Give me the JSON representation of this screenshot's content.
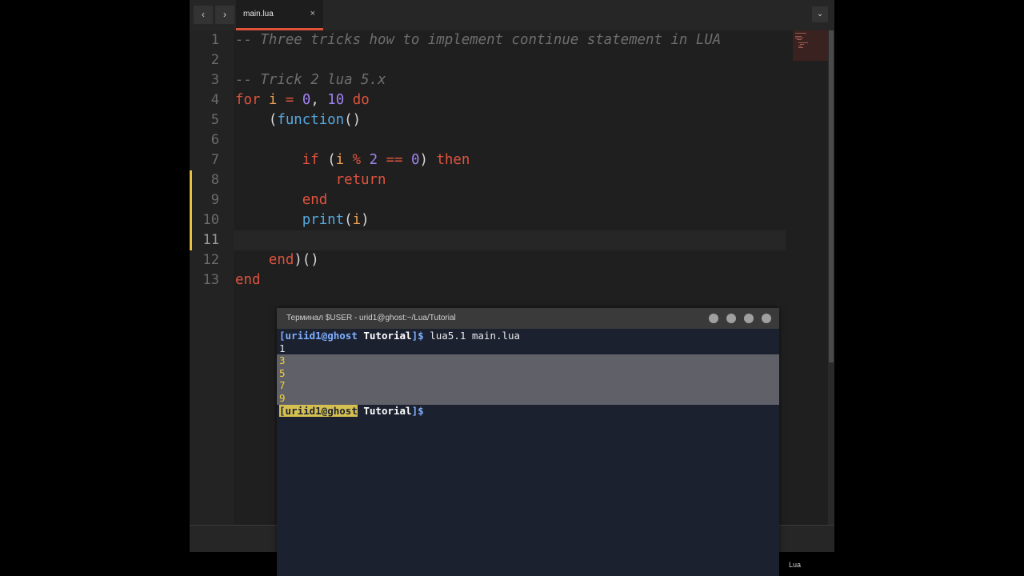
{
  "tabbar": {
    "back_icon": "‹",
    "forward_icon": "›",
    "dropdown_icon": "⌄"
  },
  "tab": {
    "label": "main.lua",
    "close": "×"
  },
  "editor": {
    "lines": [
      {
        "num": "1",
        "tokens": [
          {
            "t": "cm",
            "v": "-- Three tricks how to implement continue statement in LUA"
          }
        ]
      },
      {
        "num": "2",
        "tokens": []
      },
      {
        "num": "3",
        "tokens": [
          {
            "t": "cm",
            "v": "-- Trick 2 lua 5.x"
          }
        ]
      },
      {
        "num": "4",
        "tokens": [
          {
            "t": "kw",
            "v": "for"
          },
          {
            "t": "pl",
            "v": " "
          },
          {
            "t": "var",
            "v": "i"
          },
          {
            "t": "pl",
            "v": " "
          },
          {
            "t": "op",
            "v": "="
          },
          {
            "t": "pl",
            "v": " "
          },
          {
            "t": "num",
            "v": "0"
          },
          {
            "t": "pl",
            "v": ", "
          },
          {
            "t": "num",
            "v": "10"
          },
          {
            "t": "pl",
            "v": " "
          },
          {
            "t": "kw",
            "v": "do"
          }
        ]
      },
      {
        "num": "5",
        "tokens": [
          {
            "t": "pl",
            "v": "    ("
          },
          {
            "t": "fn",
            "v": "function"
          },
          {
            "t": "pl",
            "v": "()"
          }
        ]
      },
      {
        "num": "6",
        "tokens": []
      },
      {
        "num": "7",
        "tokens": [
          {
            "t": "pl",
            "v": "        "
          },
          {
            "t": "kw",
            "v": "if"
          },
          {
            "t": "pl",
            "v": " ("
          },
          {
            "t": "var",
            "v": "i"
          },
          {
            "t": "pl",
            "v": " "
          },
          {
            "t": "op",
            "v": "%"
          },
          {
            "t": "pl",
            "v": " "
          },
          {
            "t": "num",
            "v": "2"
          },
          {
            "t": "pl",
            "v": " "
          },
          {
            "t": "op",
            "v": "=="
          },
          {
            "t": "pl",
            "v": " "
          },
          {
            "t": "num",
            "v": "0"
          },
          {
            "t": "pl",
            "v": ") "
          },
          {
            "t": "kw",
            "v": "then"
          }
        ]
      },
      {
        "num": "8",
        "tokens": [
          {
            "t": "pl",
            "v": "            "
          },
          {
            "t": "kw",
            "v": "return"
          }
        ]
      },
      {
        "num": "9",
        "tokens": [
          {
            "t": "pl",
            "v": "        "
          },
          {
            "t": "kw",
            "v": "end"
          }
        ]
      },
      {
        "num": "10",
        "tokens": [
          {
            "t": "pl",
            "v": "        "
          },
          {
            "t": "fn",
            "v": "print"
          },
          {
            "t": "pl",
            "v": "("
          },
          {
            "t": "var",
            "v": "i"
          },
          {
            "t": "pl",
            "v": ")"
          }
        ]
      },
      {
        "num": "11",
        "tokens": []
      },
      {
        "num": "12",
        "tokens": [
          {
            "t": "pl",
            "v": "    "
          },
          {
            "t": "kw",
            "v": "end"
          },
          {
            "t": "pl",
            "v": ")()"
          }
        ]
      },
      {
        "num": "13",
        "tokens": [
          {
            "t": "kw",
            "v": "end"
          }
        ]
      }
    ]
  },
  "terminal": {
    "title": "Терминал $USER - urid1@ghost:~/Lua/Tutorial",
    "prompt_user": "uriid1@ghost",
    "prompt_dir": "Tutorial",
    "prompt_open": "[",
    "prompt_close": "]$",
    "command": "lua5.1 main.lua",
    "output": [
      "1",
      "3",
      "5",
      "7",
      "9"
    ]
  },
  "status": {
    "language": "Lua"
  },
  "colors": {
    "accent": "#e0523a",
    "keyword": "#e0533e",
    "number": "#a082ee",
    "variable": "#f0a050",
    "function": "#58a8e0",
    "comment": "#6e6e6e",
    "gutter_modified": "#e8c040"
  }
}
